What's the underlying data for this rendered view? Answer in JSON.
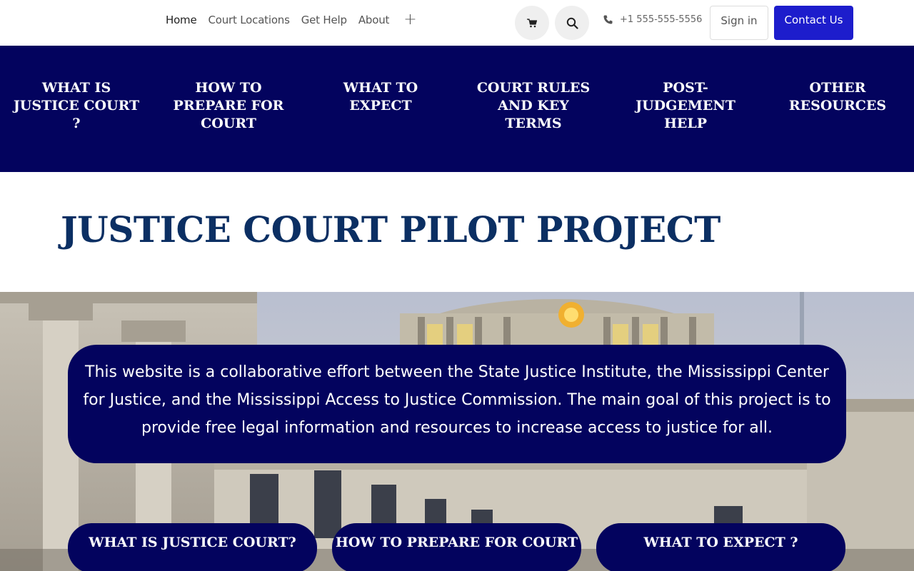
{
  "nav": {
    "links": [
      "Home",
      "Court Locations",
      "Get Help",
      "About"
    ],
    "more_label": "+"
  },
  "header": {
    "cart_icon": "cart-icon",
    "search_icon": "search-icon",
    "phone_icon": "phone-icon",
    "phone": "+1 555-555-5556",
    "signin_label": "Sign in",
    "contact_label": "Contact Us"
  },
  "categories": [
    "WHAT IS JUSTICE COURT ?",
    "HOW TO PREPARE FOR COURT",
    "WHAT TO EXPECT",
    "COURT RULES AND KEY TERMS",
    "POST-JUDGEMENT HELP",
    "OTHER RESOURCES"
  ],
  "title": "JUSTICE COURT PILOT PROJECT",
  "intro_text": "This website is a collaborative effort between the State Justice Institute, the Mississippi Center for Justice, and the Mississippi Access to Justice Commission. The main goal of this project is to provide free legal information and resources to increase access to justice for all.",
  "pills": [
    "WHAT IS JUSTICE COURT?",
    "HOW TO PREPARE FOR COURT",
    "WHAT TO EXPECT ?"
  ],
  "colors": {
    "navy": "#03035e",
    "title_blue": "#0b2f63",
    "contact_blue": "#1d1dcc"
  }
}
